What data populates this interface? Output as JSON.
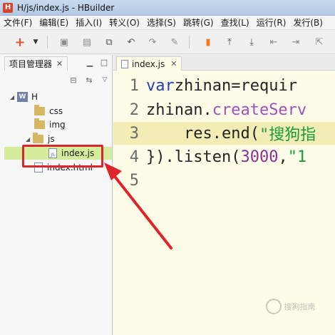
{
  "window": {
    "title": "H/js/index.js  -  HBuilder",
    "logo_letter": "H"
  },
  "menu": [
    "文件(F)",
    "编辑(E)",
    "插入(I)",
    "转义(O)",
    "选择(S)",
    "跳转(G)",
    "查找(L)",
    "运行(R)",
    "发行(B)"
  ],
  "toolbar": {
    "icons": [
      "new-icon",
      "dropdown-arrow-icon",
      "save-icon",
      "save-all-icon",
      "copy-icon",
      "undo-icon",
      "redo-icon",
      "format-icon",
      "bookmark-icon",
      "go-to-top-icon",
      "go-to-bottom-icon",
      "previous-icon",
      "next-icon",
      "export-icon"
    ]
  },
  "explorer": {
    "title": "项目管理器",
    "close": "✕",
    "tree": {
      "project": "H",
      "css": "css",
      "img": "img",
      "js": "js",
      "index_js": "index.js",
      "index_html": "index.html"
    }
  },
  "editor": {
    "tab_label": "index.js",
    "close": "✕",
    "lines": [
      {
        "n": "1",
        "kw": "var",
        "text": " zhinan=requir"
      },
      {
        "n": "2",
        "obj": "zhinan.",
        "fn": "createServ"
      },
      {
        "n": "3",
        "pre": "    res.end(",
        "str": "\"搜狗指"
      },
      {
        "n": "4",
        "pre": "}).listen(",
        "num": "3000",
        "post": ",",
        "str": "\"1"
      },
      {
        "n": "5"
      }
    ]
  },
  "watermark": {
    "text": "搜狗指南"
  },
  "colors": {
    "annotation_red": "#e0242b",
    "selection_green": "#d6ec9d",
    "editor_background": "#fffde8"
  }
}
